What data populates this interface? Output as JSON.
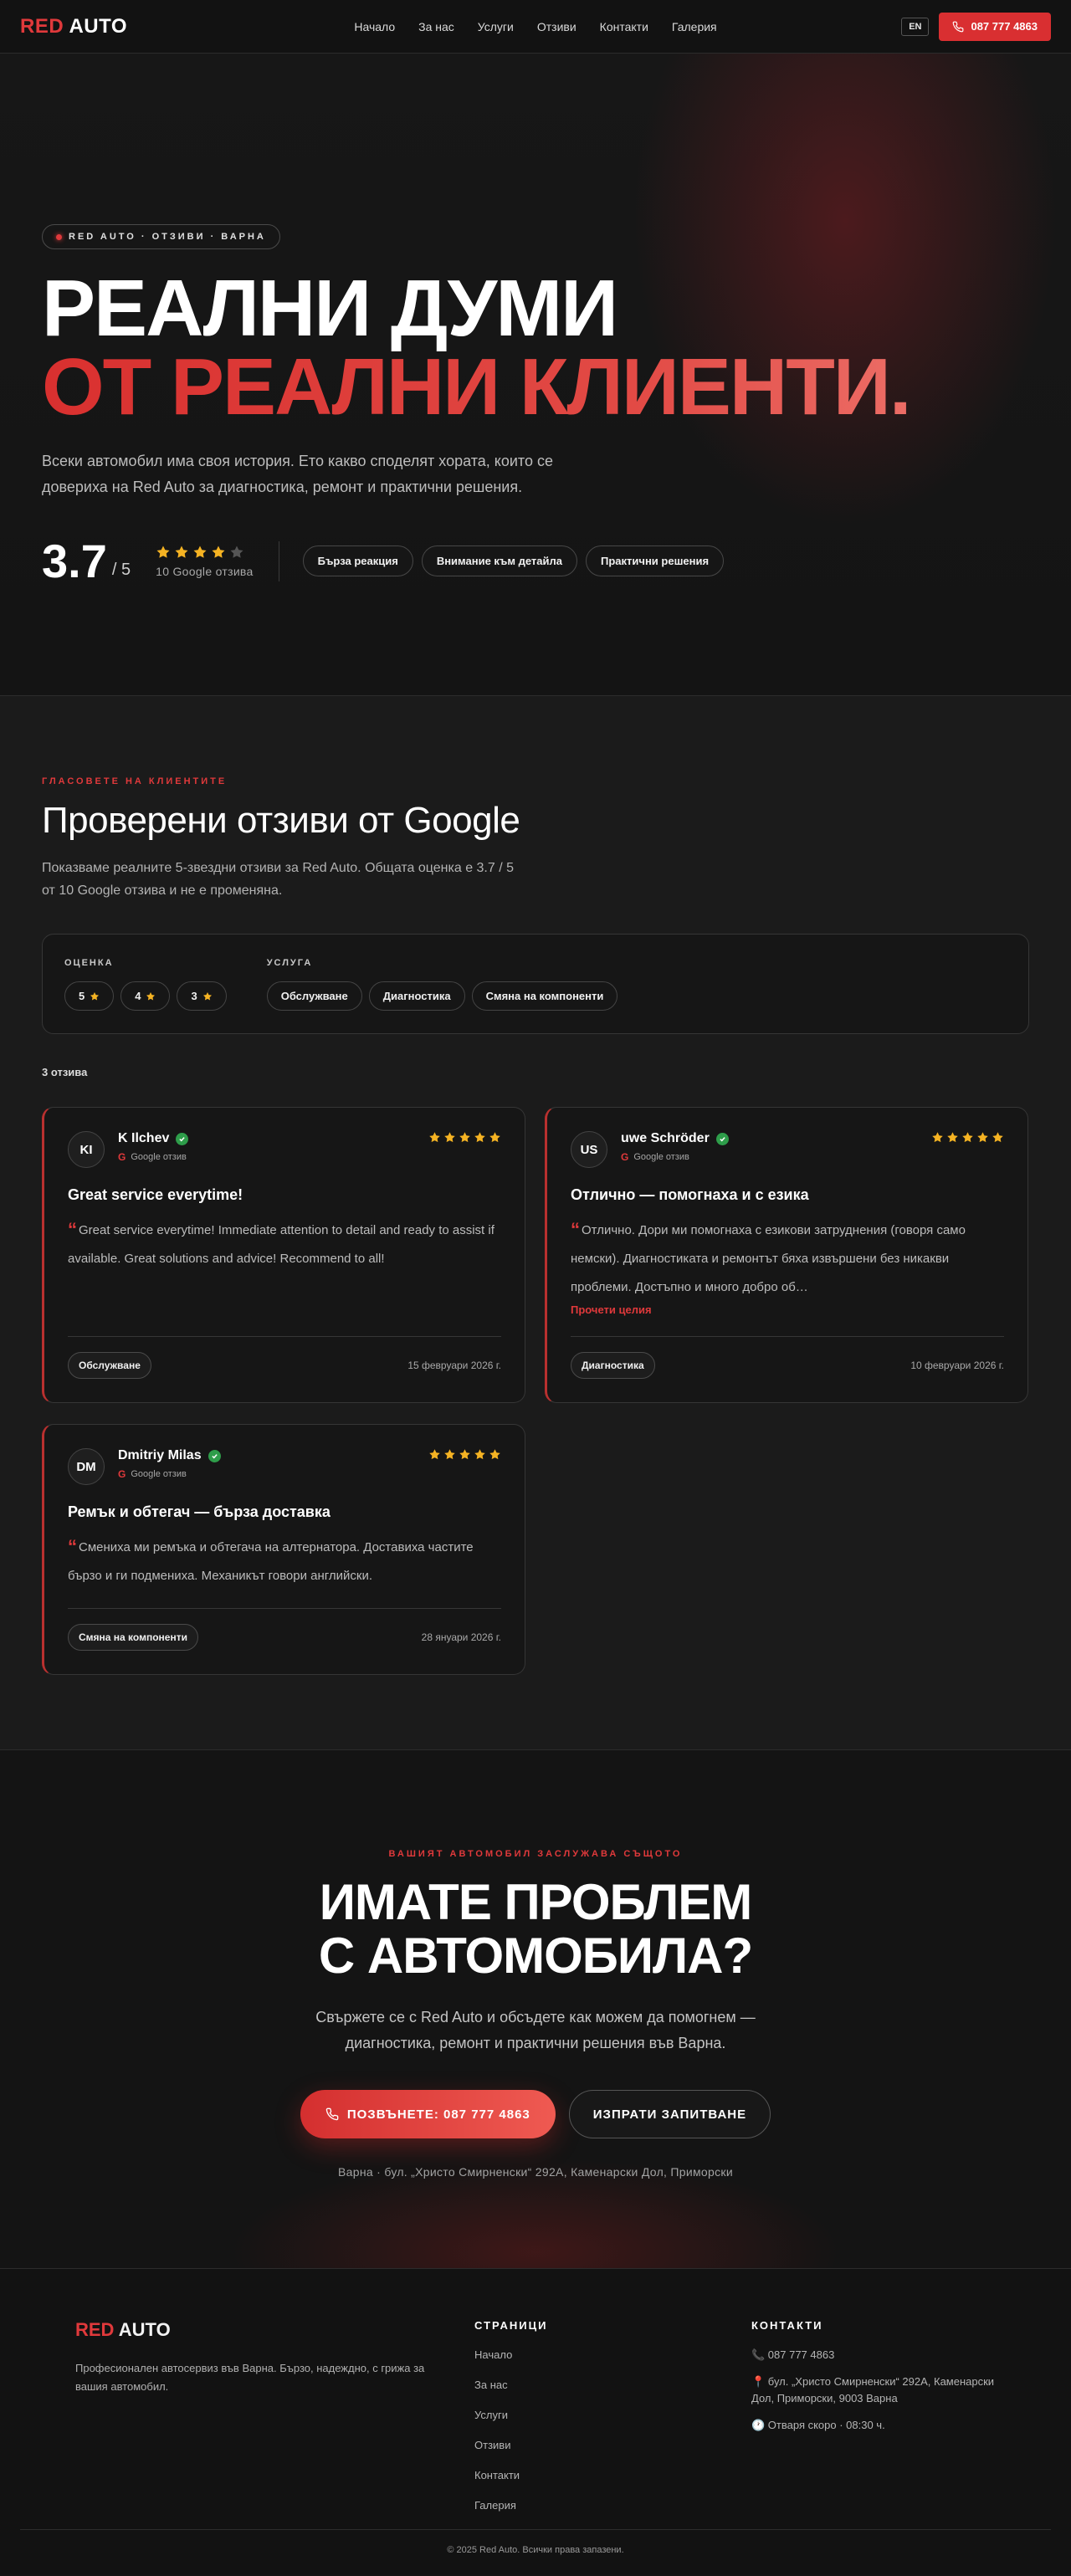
{
  "nav": {
    "logo_red": "RED",
    "logo_white": "AUTO",
    "links": [
      "Начало",
      "За нас",
      "Услуги",
      "Отзиви",
      "Контакти",
      "Галерия"
    ],
    "lang": "EN",
    "phone": "087 777 4863"
  },
  "hero": {
    "tag": "RED AUTO · ОТЗИВИ · ВАРНА",
    "title_line1": "РЕАЛНИ ДУМИ",
    "title_line2": "ОТ РЕАЛНИ КЛИЕНТИ.",
    "lead": "Всеки автомобил има своя история. Ето какво споделят хората, които се довериха на Red Auto за диагностика, ремонт и практични решения.",
    "score": "3.7",
    "score_of": "/ 5",
    "stars_filled": 4,
    "stars_total": 5,
    "review_count": "10 Google отзива",
    "chips": [
      "Бърза реакция",
      "Внимание към детайла",
      "Практични решения"
    ]
  },
  "reviews": {
    "eyebrow": "ГЛАСОВЕТЕ НА КЛИЕНТИТЕ",
    "title": "Проверени отзиви от Google",
    "subtitle": "Показваме реалните 5-звездни отзиви за Red Auto. Общата оценка е 3.7 / 5 от 10 Google отзива и не е променяна.",
    "filter_rating_label": "ОЦЕНКА",
    "rating_filters": [
      "5",
      "4",
      "3"
    ],
    "filter_service_label": "УСЛУГА",
    "service_filters": [
      "Обслужване",
      "Диагностика",
      "Смяна на компоненти"
    ],
    "count": "3 отзива",
    "source_label": "Google отзив",
    "read_more": "Прочети целия",
    "items": [
      {
        "initials": "KI",
        "name": "K Ilchev",
        "stars": 5,
        "title": "Great service everytime!",
        "body": "Great service everytime! Immediate attention to detail and ready to assist if available. Great solutions and advice! Recommend to all!",
        "tag": "Обслужване",
        "date": "15 февруари 2026 г."
      },
      {
        "initials": "US",
        "name": "uwe Schröder",
        "stars": 5,
        "title": "Отлично — помогнаха и с езика",
        "body": "Отлично. Дори ми помогнаха с езикови затруднения (говоря само немски). Диагностиката и ремонтът бяха извършени без никакви проблеми. Достъпно и много добро об…",
        "tag": "Диагностика",
        "date": "10 февруари 2026 г."
      },
      {
        "initials": "DM",
        "name": "Dmitriy Milas",
        "stars": 5,
        "title": "Ремък и обтегач — бърза доставка",
        "body": "Смениха ми ремъка и обтегача на алтернатора. Доставиха частите бързо и ги подмениха. Механикът говори английски.",
        "tag": "Смяна на компоненти",
        "date": "28 януари 2026 г."
      }
    ]
  },
  "cta": {
    "eyebrow": "ВАШИЯТ АВТОМОБИЛ ЗАСЛУЖАВА СЪЩОТО",
    "title_line1": "ИМАТЕ ПРОБЛЕМ",
    "title_line2": "С АВТОМОБИЛА?",
    "text": "Свържете се с Red Auto и обсъдете как можем да помогнем — диагностика, ремонт и практични решения във Варна.",
    "call_label": "ПОЗВЪНЕТЕ: 087 777 4863",
    "request_label": "ИЗПРАТИ ЗАПИТВАНЕ",
    "address": "Варна · бул. „Христо Смирненски“ 292А, Каменарски Дол, Приморски"
  },
  "footer": {
    "logo_red": "RED",
    "logo_white": "AUTO",
    "desc": "Професионален автосервиз във Варна. Бързо, надеждно, с грижа за вашия автомобил.",
    "pages_title": "СТРАНИЦИ",
    "pages": [
      "Начало",
      "За нас",
      "Услуги",
      "Отзиви",
      "Контакти",
      "Галерия"
    ],
    "contacts_title": "КОНТАКТИ",
    "phone": "📞 087 777 4863",
    "address": "📍 бул. „Христо Смирненски“ 292А, Каменарски Дол, Приморски, 9003 Варна",
    "hours": "🕐 Отваря скоро · 08:30 ч.",
    "copyright": "© 2025 Red Auto. Всички права запазени."
  },
  "colors": {
    "accent": "#e0393b",
    "star": "#f5b323",
    "verified": "#2e9d4a",
    "background": "#141414"
  },
  "icons": [
    "phone-icon",
    "star-icon",
    "verified-check-icon",
    "google-g-icon",
    "quote-icon",
    "pulse-dot-icon"
  ]
}
